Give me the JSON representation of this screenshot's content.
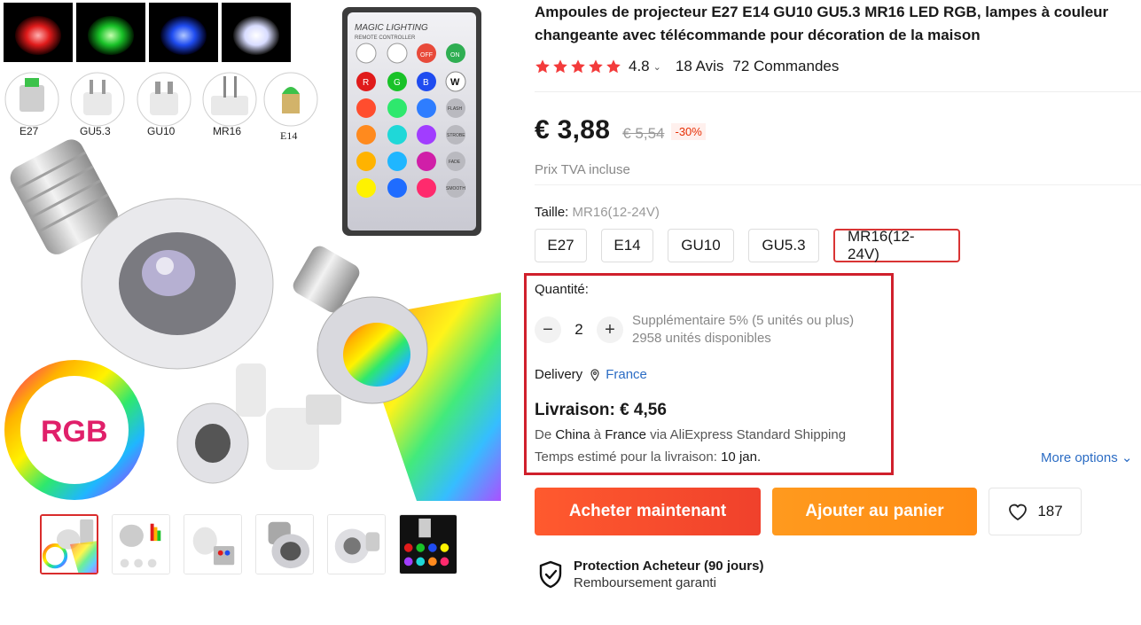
{
  "gallery": {
    "main_image": {
      "color_chips": [
        "#e01b1b",
        "#19c228",
        "#1f4cf0",
        "#e6e6ff"
      ],
      "socket_labels": [
        "E27",
        "GU5.3",
        "GU10",
        "MR16",
        "E14"
      ],
      "remote_title": "MAGIC LIGHTING",
      "remote_subtitle": "REMOTE CONTROLLER",
      "remote_buttons": [
        "OFF",
        "ON",
        "R",
        "G",
        "B",
        "W",
        "FLASH",
        "STROBE",
        "FADE",
        "SMOOTH"
      ],
      "rgb_badge": "RGB"
    },
    "thumbnail_count": 6,
    "active_thumbnail": 1
  },
  "product": {
    "title": "Ampoules de projecteur E27 E14 GU10 GU5.3 MR16 LED RGB, lampes à couleur changeante avec télécommande pour décoration de la maison",
    "rating": "4.8",
    "stars": 5,
    "reviews": "18 Avis",
    "orders": "72 Commandes",
    "price": "€ 3,88",
    "old_price": "€ 5,54",
    "discount": "-30%",
    "tva": "Prix TVA incluse"
  },
  "size": {
    "label": "Taille:",
    "selected": "MR16(12-24V)",
    "options": [
      "E27",
      "E14",
      "GU10",
      "GU5.3",
      "MR16(12-24V)"
    ]
  },
  "quantity": {
    "label": "Quantité:",
    "value": "2",
    "minus": "−",
    "plus": "+",
    "bulk_note": "Supplémentaire 5% (5 unités ou plus)",
    "stock": "2958 unités disponibles"
  },
  "delivery": {
    "label": "Delivery",
    "country": "France",
    "shipping_title": "Livraison: € 4,56",
    "route_from_prefix": "De ",
    "route_from": "China",
    "route_to_prefix": " à ",
    "route_to": "France",
    "route_method": " via AliExpress Standard Shipping",
    "time_prefix": "Temps estimé pour la livraison: ",
    "time_value": "10 jan.",
    "more_options": "More options"
  },
  "actions": {
    "buy_now": "Acheter maintenant",
    "add_to_cart": "Ajouter au panier",
    "wishlist_count": "187"
  },
  "protection": {
    "title": "Protection Acheteur (90 jours)",
    "subtitle": "Remboursement garanti"
  },
  "colors": {
    "accent_red": "#e62e04",
    "buy_orange_red": "#f0412c",
    "cart_orange": "#ff8c14",
    "link_blue": "#2b6cc4",
    "star_red": "#f33b3b",
    "highlight_border": "#d0202c"
  }
}
